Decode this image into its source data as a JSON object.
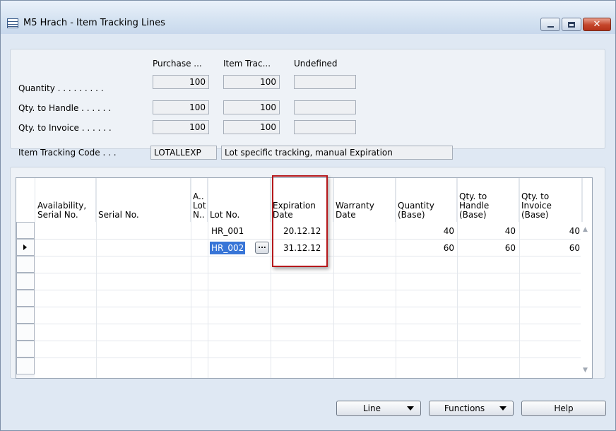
{
  "window": {
    "title": "M5 Hrach - Item Tracking Lines",
    "close_glyph": "✕"
  },
  "summary": {
    "columns": [
      "Purchase ...",
      "Item Trac...",
      "Undefined"
    ],
    "rows": [
      {
        "label": "Quantity . . . . . . . . .",
        "values": [
          "100",
          "100",
          ""
        ]
      },
      {
        "label": "Qty. to Handle . . . . . .",
        "values": [
          "100",
          "100",
          ""
        ]
      },
      {
        "label": "Qty. to Invoice . . . . . .",
        "values": [
          "100",
          "100",
          ""
        ]
      }
    ],
    "tracking_code_label": "Item Tracking Code . . .",
    "tracking_code_value": "LOTALLEXP",
    "tracking_code_desc": "Lot specific tracking, manual Expiration"
  },
  "grid": {
    "headers": {
      "availability_serial": "Availability,\nSerial No.",
      "serial_no": "Serial No.",
      "availability_lot": "A..\nLot\nN..",
      "lot_no": "Lot No.",
      "expiration_date": "Expiration\nDate",
      "warranty_date": "Warranty\nDate",
      "quantity_base": "Quantity\n(Base)",
      "qty_handle_base": "Qty. to\nHandle\n(Base)",
      "qty_invoice_base": "Qty. to\nInvoice\n(Base)"
    },
    "rows": [
      {
        "lot_no": "HR_001",
        "expiration_date": "20.12.12",
        "quantity": "40",
        "qty_handle": "40",
        "qty_invoice": "40"
      },
      {
        "lot_no": "HR_002",
        "expiration_date": "31.12.12",
        "quantity": "60",
        "qty_handle": "60",
        "qty_invoice": "60"
      }
    ],
    "assist_glyph": "...",
    "scroll_up": "▲",
    "scroll_down": "▼"
  },
  "footer": {
    "line_label": "Line",
    "functions_label": "Functions",
    "help_label": "Help"
  },
  "colors": {
    "highlight_box": "#b5181b",
    "selection": "#3875d7"
  }
}
